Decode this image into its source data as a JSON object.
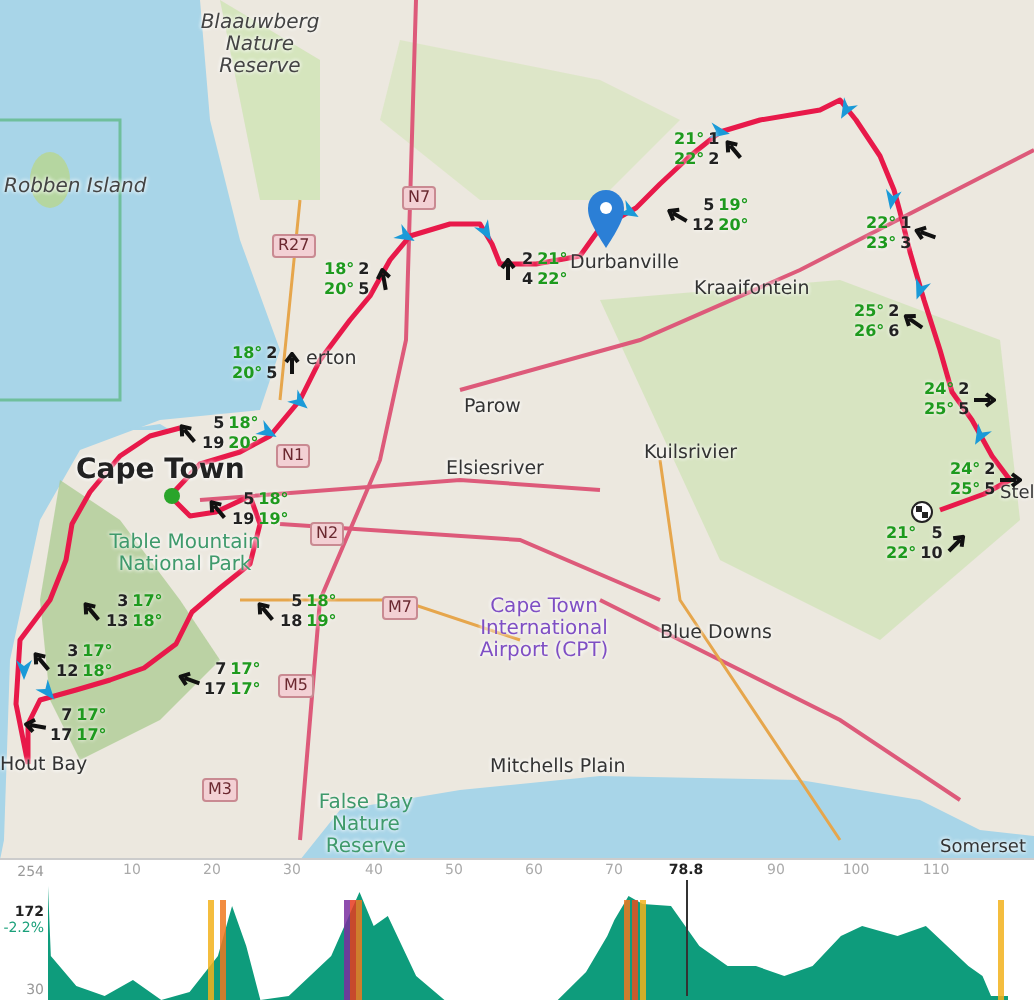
{
  "map": {
    "places": [
      {
        "kind": "reserve",
        "text": "Blaauwberg Nature Reserve"
      },
      {
        "kind": "reserve",
        "text": "Robben Island"
      },
      {
        "kind": "road",
        "text": "N7"
      },
      {
        "kind": "road",
        "text": "R27"
      },
      {
        "kind": "town",
        "text": "erton"
      },
      {
        "kind": "town",
        "text": "Parow"
      },
      {
        "kind": "town",
        "text": "Durbanville"
      },
      {
        "kind": "town",
        "text": "Kraaifontein"
      },
      {
        "kind": "city",
        "text": "Cape Town"
      },
      {
        "kind": "park",
        "text": "Table Mountain National Park"
      },
      {
        "kind": "road",
        "text": "N1"
      },
      {
        "kind": "town",
        "text": "Elsiesriver"
      },
      {
        "kind": "road",
        "text": "N2"
      },
      {
        "kind": "town",
        "text": "Kuilsrivier"
      },
      {
        "kind": "road",
        "text": "M7"
      },
      {
        "kind": "airport",
        "text": "Cape Town International Airport (CPT)"
      },
      {
        "kind": "road",
        "text": "M5"
      },
      {
        "kind": "town",
        "text": "Blue Downs"
      },
      {
        "kind": "road",
        "text": "M3"
      },
      {
        "kind": "town",
        "text": "Mitchells Plain"
      },
      {
        "kind": "park",
        "text": "False Bay Nature Reserve"
      },
      {
        "kind": "town",
        "text": "Somerset"
      },
      {
        "kind": "town",
        "text": "Stel"
      },
      {
        "kind": "town",
        "text": "Hout Bay"
      }
    ],
    "weather_markers": [
      {
        "kind": "temps_left",
        "temps": [
          "18°",
          "20°"
        ],
        "winds": [
          "2",
          "5"
        ]
      },
      {
        "kind": "temps_left",
        "temps": [
          "18°",
          "20°"
        ],
        "winds": [
          "2",
          "5"
        ]
      },
      {
        "kind": "winds_left",
        "temps": [
          "21°",
          "22°"
        ],
        "winds": [
          "2",
          "4"
        ]
      },
      {
        "kind": "temps_left",
        "temps": [
          "21°",
          "22°"
        ],
        "winds": [
          "1",
          "2"
        ]
      },
      {
        "kind": "winds_left",
        "temps": [
          "19°",
          "20°"
        ],
        "winds": [
          "5",
          "12"
        ]
      },
      {
        "kind": "temps_left",
        "temps": [
          "22°",
          "23°"
        ],
        "winds": [
          "1",
          "3"
        ]
      },
      {
        "kind": "temps_left",
        "temps": [
          "25°",
          "26°"
        ],
        "winds": [
          "2",
          "6"
        ]
      },
      {
        "kind": "temps_left",
        "temps": [
          "24°",
          "25°"
        ],
        "winds": [
          "2",
          "5"
        ]
      },
      {
        "kind": "temps_left",
        "temps": [
          "24°",
          "25°"
        ],
        "winds": [
          "2",
          "5"
        ]
      },
      {
        "kind": "temps_left",
        "temps": [
          "21°",
          "22°"
        ],
        "winds": [
          "5",
          "10"
        ]
      },
      {
        "kind": "winds_left",
        "temps": [
          "18°",
          "20°"
        ],
        "winds": [
          "5",
          "19"
        ]
      },
      {
        "kind": "winds_left",
        "temps": [
          "18°",
          "19°"
        ],
        "winds": [
          "5",
          "19"
        ]
      },
      {
        "kind": "winds_left",
        "temps": [
          "17°",
          "18°"
        ],
        "winds": [
          "3",
          "13"
        ]
      },
      {
        "kind": "winds_left",
        "temps": [
          "18°",
          "19°"
        ],
        "winds": [
          "5",
          "18"
        ]
      },
      {
        "kind": "winds_left",
        "temps": [
          "17°",
          "18°"
        ],
        "winds": [
          "3",
          "12"
        ]
      },
      {
        "kind": "winds_left",
        "temps": [
          "17°",
          "17°"
        ],
        "winds": [
          "7",
          "17"
        ]
      },
      {
        "kind": "winds_left",
        "temps": [
          "17°",
          "17°"
        ],
        "winds": [
          "7",
          "17"
        ]
      }
    ]
  },
  "elevation_profile": {
    "y_max": "254",
    "y_min": "30",
    "x_ticks": [
      "10",
      "20",
      "30",
      "40",
      "50",
      "60",
      "70",
      "90",
      "100",
      "110"
    ],
    "cursor": {
      "distance": "78.8",
      "elevation": "172",
      "grade": "-2.2%"
    }
  }
}
